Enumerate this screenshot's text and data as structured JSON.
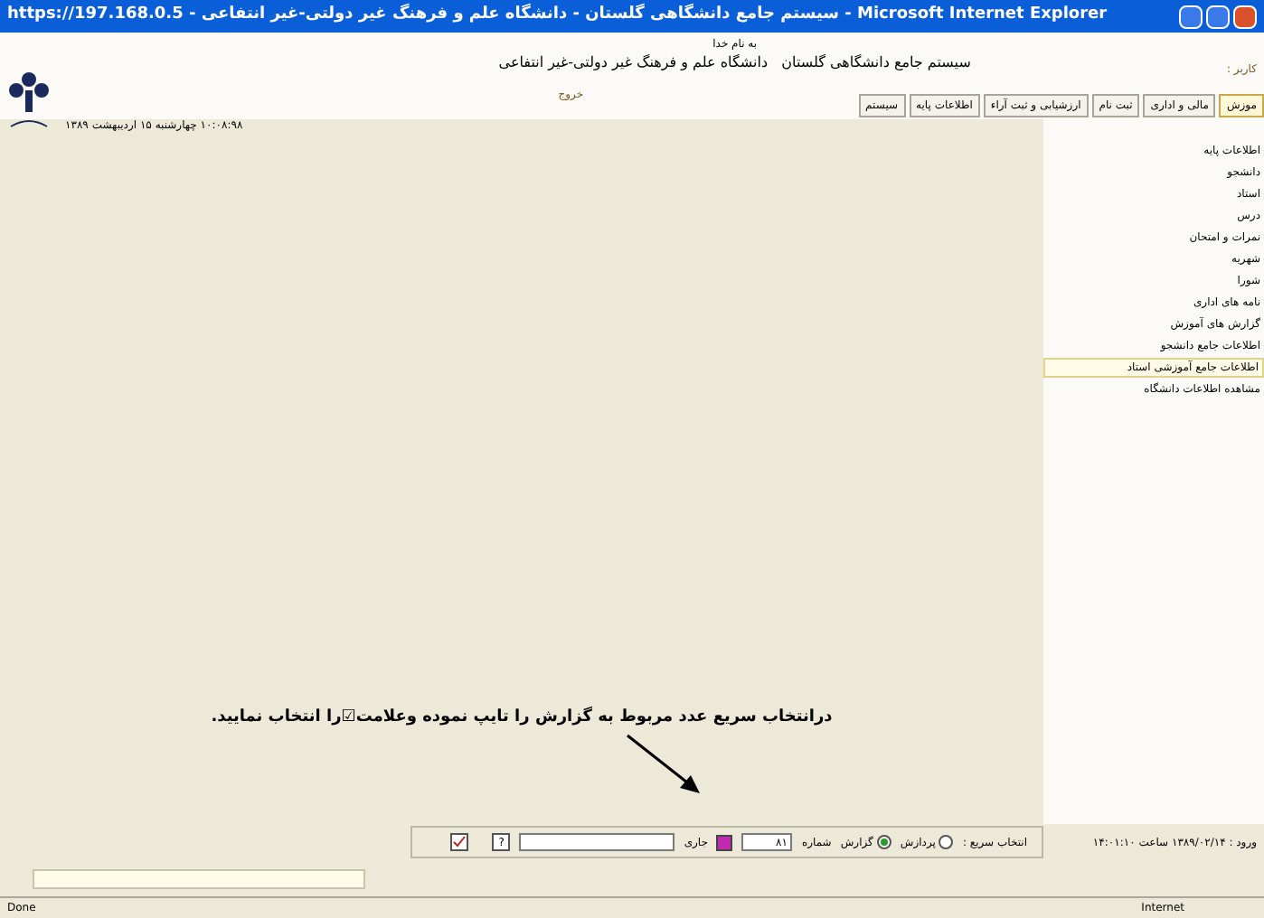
{
  "window": {
    "title": "https://197.168.0.5 - سیستم جامع دانشگاهی گلستان - دانشگاه علم و فرهنگ غیر دولتی-غیر انتفاعی - Microsoft Internet Explorer"
  },
  "header": {
    "motto": "به نام خدا",
    "system_name": "سیستم جامع دانشگاهی گلستان   دانشگاه علم و فرهنگ غیر دولتی-غیر انتفاعی",
    "datetime": "۱۰:۰۸:۹۸ چهارشنبه ۱۵ اردیبهشت ۱۳۸۹",
    "user_label": "کاربر :",
    "logout": "خروج"
  },
  "tabs": [
    {
      "label": "موزش",
      "selected": true
    },
    {
      "label": "مالی و اداری",
      "selected": false
    },
    {
      "label": "ثبت نام",
      "selected": false
    },
    {
      "label": "ارزشیابی و ثبت آراء",
      "selected": false
    },
    {
      "label": "اطلاعات پایه",
      "selected": false
    },
    {
      "label": "سیستم",
      "selected": false
    }
  ],
  "menu": [
    {
      "label": "اطلاعات پایه",
      "selected": false
    },
    {
      "label": "دانشجو",
      "selected": false
    },
    {
      "label": "استاد",
      "selected": false
    },
    {
      "label": "درس",
      "selected": false
    },
    {
      "label": "نمرات و امتحان",
      "selected": false
    },
    {
      "label": "شهریه",
      "selected": false
    },
    {
      "label": "شورا",
      "selected": false
    },
    {
      "label": "نامه های اداری",
      "selected": false
    },
    {
      "label": "گزارش های آموزش",
      "selected": false
    },
    {
      "label": "اطلاعات جامع دانشجو",
      "selected": false
    },
    {
      "label": "اطلاعات جامع آموزشی استاد",
      "selected": true
    },
    {
      "label": "مشاهده اطلاعات دانشگاه",
      "selected": false
    }
  ],
  "instruction": "درانتخاب سریع عدد مربوط به گزارش را تایپ نموده وعلامت☑را انتخاب نمایید.",
  "quick_bar": {
    "login_info": "ورود : ۱۳۸۹/۰۲/۱۴ ساعت ۱۴:۰۱:۱۰",
    "label": "انتخاب سریع :",
    "options": [
      {
        "label": "پردازش",
        "selected": false
      },
      {
        "label": "گزارش",
        "selected": true
      }
    ],
    "number_label": "شماره",
    "number_value": "۸۱",
    "current_label": "جاری",
    "help": "?"
  },
  "status_bar": {
    "left": "Done",
    "zone": "Internet"
  }
}
